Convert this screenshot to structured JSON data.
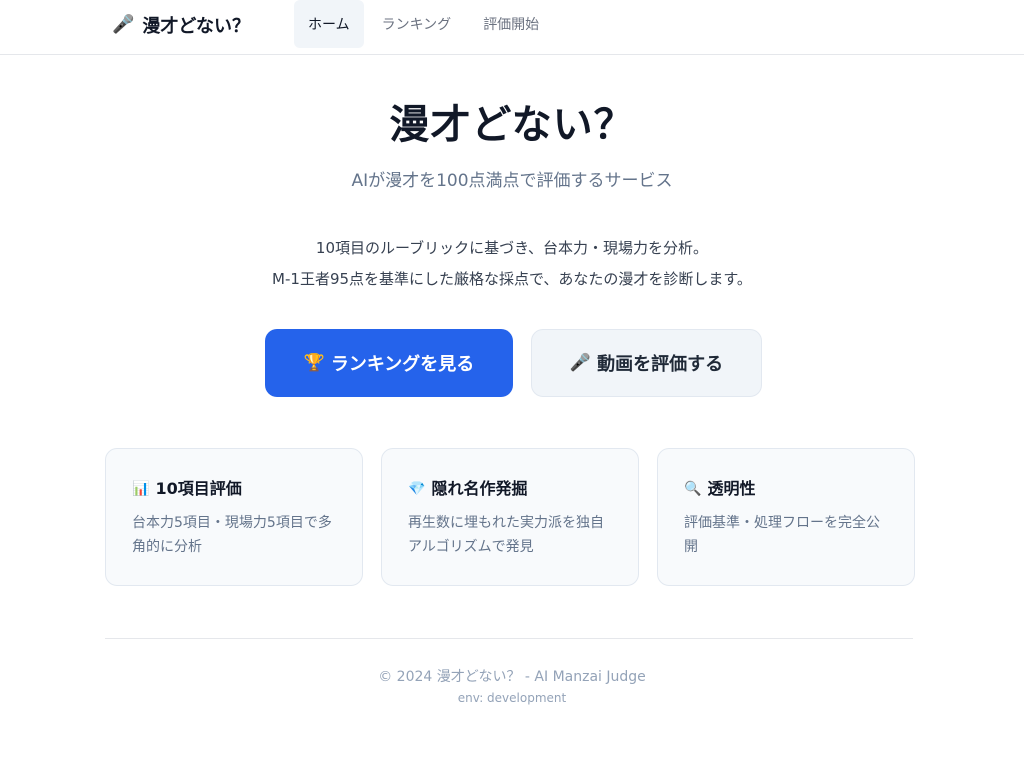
{
  "header": {
    "brand_icon": "🎤",
    "brand": "漫才どない？",
    "nav": [
      {
        "label": "ホーム",
        "active": true
      },
      {
        "label": "ランキング",
        "active": false
      },
      {
        "label": "評価開始",
        "active": false
      }
    ]
  },
  "hero": {
    "title": "漫才どない？",
    "subtitle": "AIが漫才を100点満点で評価するサービス",
    "desc_line1": "10項目のルーブリックに基づき、台本力・現場力を分析。",
    "desc_line2": "M-1王者95点を基準にした厳格な採点で、あなたの漫才を診断します。"
  },
  "cta": {
    "primary_icon": "🏆",
    "primary_label": "ランキングを見る",
    "secondary_icon": "🎤",
    "secondary_label": "動画を評価する"
  },
  "features": [
    {
      "icon": "📊",
      "title": "10項目評価",
      "text": "台本力5項目・現場力5項目で多角的に分析"
    },
    {
      "icon": "💎",
      "title": "隠れ名作発掘",
      "text": "再生数に埋もれた実力派を独自アルゴリズムで発見"
    },
    {
      "icon": "🔍",
      "title": "透明性",
      "text": "評価基準・処理フローを完全公開"
    }
  ],
  "footer": {
    "copyright": "© 2024 漫才どない？ - AI Manzai Judge",
    "env": "env: development"
  },
  "colors": {
    "primary": "#2563eb",
    "secondary_bg": "#f1f5f9",
    "card_bg": "#f8fafc",
    "muted_text": "#64748b"
  }
}
